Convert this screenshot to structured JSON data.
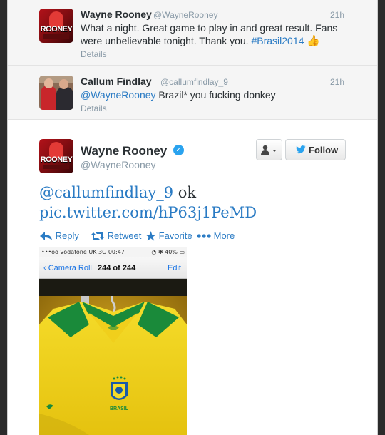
{
  "tweet1": {
    "name": "Wayne Rooney",
    "handle": "@WayneRooney",
    "time": "21h",
    "text_line1": "What a night. Great game to play in and great result. Fans",
    "text_line2_plain": "were unbelievable tonight. Thank you. ",
    "hashtag": "#Brasil2014",
    "emoji": "👍",
    "details": "Details",
    "avatar_text": "ROONEY"
  },
  "tweet2": {
    "name": "Callum Findlay",
    "handle": "@callumfindlay_9",
    "time": "21h",
    "mention": "@WayneRooney",
    "text_rest": " Brazil* you fucking donkey",
    "details": "Details"
  },
  "main_tweet": {
    "name": "Wayne Rooney",
    "handle": "@WayneRooney",
    "verified_icon": "✓",
    "avatar_text": "ROONEY",
    "mention": "@callumfindlay_9",
    "text_rest": " ok",
    "pic_link": "pic.twitter.com/hP63j1PeMD",
    "follow_label": "Follow",
    "user_menu_icon": "person-dropdown-icon",
    "actions": {
      "reply": "Reply",
      "retweet": "Retweet",
      "favorite": "Favorite",
      "more": "More"
    }
  },
  "photo": {
    "status_left": "•••oo vodafone UK  3G  00:47",
    "status_right": "◔ ✱ 40% ▭",
    "back_label": "Camera Roll",
    "title": "244 of 244",
    "edit_label": "Edit",
    "shirt_text": "BRASIL"
  },
  "colors": {
    "link": "#2a7bc4",
    "verified": "#2aa3ef",
    "shirt_yellow": "#f2d41a",
    "shirt_green": "#1a8a3a"
  }
}
